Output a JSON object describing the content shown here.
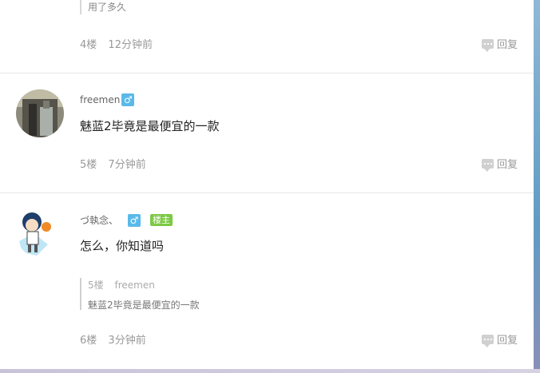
{
  "posts": [
    {
      "quote_text": "用了多久",
      "floor": "4楼",
      "time": "12分钟前",
      "reply_label": "回复"
    },
    {
      "username": "freemen",
      "gender": "♂",
      "content": "魅蓝2毕竟是最便宜的一款",
      "floor": "5楼",
      "time": "7分钟前",
      "reply_label": "回复"
    },
    {
      "username": "づ執念、",
      "gender": "♂",
      "owner_badge": "楼主",
      "content": "怎么，你知道吗",
      "quote": {
        "floor": "5楼",
        "user": "freemen",
        "text": "魅蓝2毕竟是最便宜的一款"
      },
      "floor": "6楼",
      "time": "3分钟前",
      "reply_label": "回复"
    }
  ],
  "colors": {
    "gender_badge": "#5ab9ea",
    "owner_badge": "#7bc944"
  },
  "icons": {
    "reply": "comment-bubble-icon",
    "gender": "male-icon"
  }
}
